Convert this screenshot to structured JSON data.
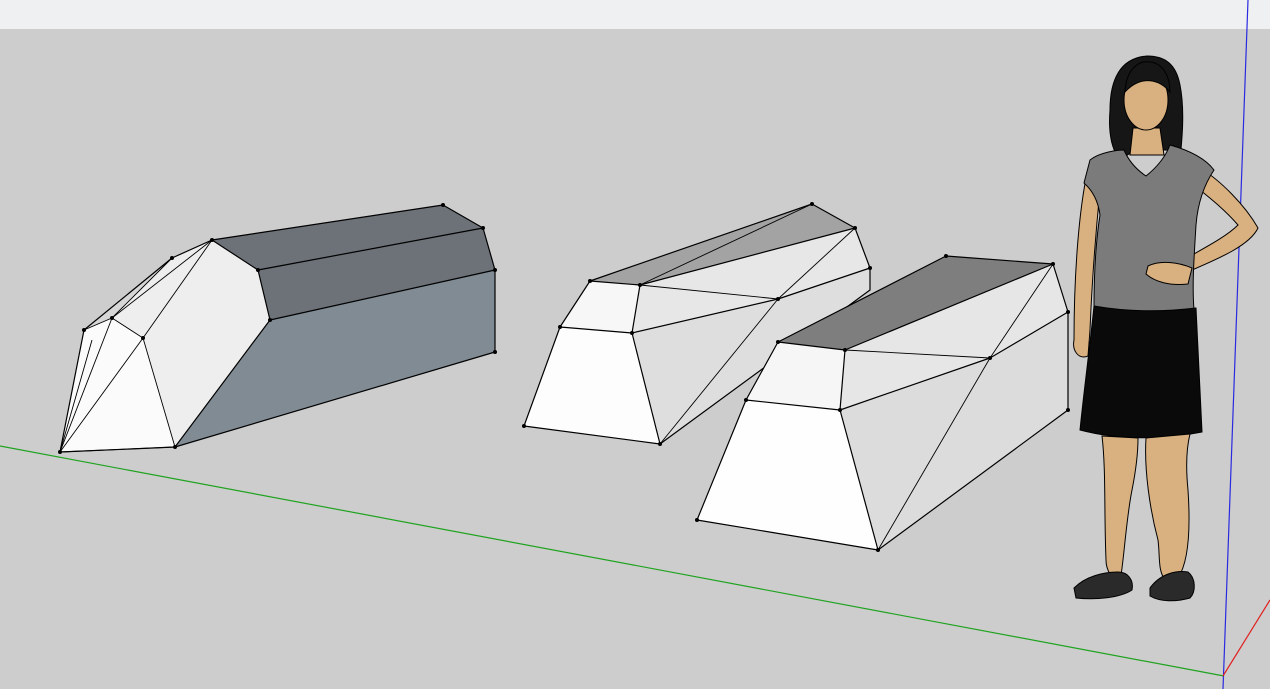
{
  "viewport": {
    "title": "",
    "background_sky": "#eef0f2",
    "background_ground": "#cdcdcd"
  },
  "axes": {
    "green": "#1fa31f",
    "blue": "#2a2ae0",
    "red": "#e02020"
  },
  "models": [
    {
      "name": "model-1",
      "face_dark": "#808a93",
      "face_top": "#6c7177",
      "face_light": "#f4f4f4"
    },
    {
      "name": "model-2",
      "face_dark": "#a6a6a6",
      "face_light": "#e6e6e6"
    },
    {
      "name": "model-3",
      "face_dark": "#7e7e7e",
      "face_light": "#e4e4e4"
    }
  ],
  "figure": {
    "name": "scale-figure",
    "skin": "#d9b07f",
    "shirt": "#7b7b7b",
    "skirt": "#0a0a0a",
    "hair": "#151515"
  }
}
